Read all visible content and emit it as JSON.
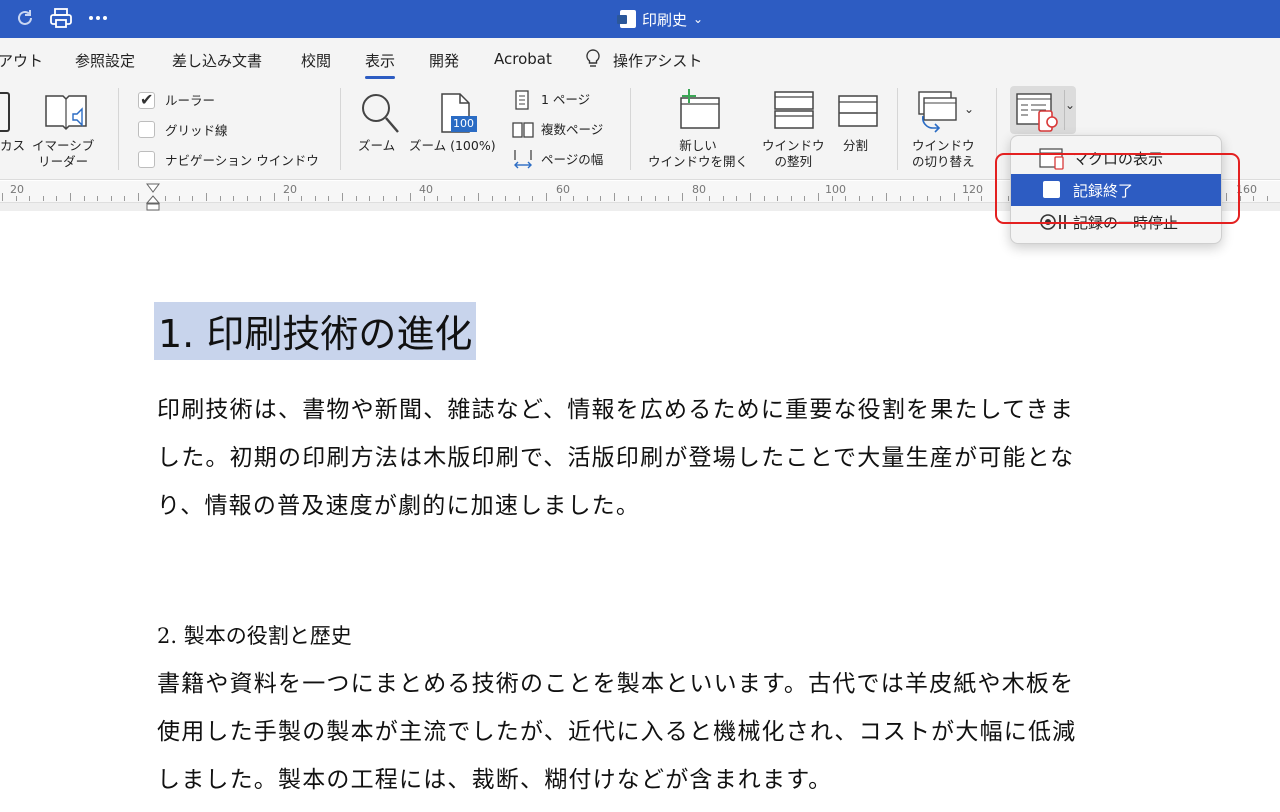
{
  "window": {
    "title": "印刷史"
  },
  "tabs": [
    {
      "label": "アウト"
    },
    {
      "label": "参照設定"
    },
    {
      "label": "差し込み文書"
    },
    {
      "label": "校閲"
    },
    {
      "label": "表示"
    },
    {
      "label": "開発"
    },
    {
      "label": "Acrobat"
    },
    {
      "label": "操作アシスト"
    }
  ],
  "ribbon": {
    "focus_label": "カス",
    "immersive_label": "イマーシブ",
    "immersive_label2": "リーダー",
    "ruler": "ルーラー",
    "gridlines": "グリッド線",
    "navigation": "ナビゲーション ウインドウ",
    "zoom": "ズーム",
    "zoom100": "ズーム (100%)",
    "zoom100_badge": "100",
    "one_page": "1 ページ",
    "multi_page": "複数ページ",
    "page_width": "ページの幅",
    "new_window_1": "新しい",
    "new_window_2": "ウインドウを開く",
    "arrange_1": "ウインドウ",
    "arrange_2": "の整列",
    "split": "分割",
    "switch_1": "ウインドウ",
    "switch_2": "の切り替え"
  },
  "ruler": {
    "numbers": [
      "20",
      "20",
      "40",
      "60",
      "80",
      "100",
      "120",
      "160"
    ]
  },
  "macro_menu": {
    "items": [
      {
        "label": "マクロの表示"
      },
      {
        "label": "記録終了"
      },
      {
        "label": "記録の一時停止"
      }
    ]
  },
  "document": {
    "heading1": "1. 印刷技術の進化",
    "para1": [
      "印刷技術は、書物や新聞、雑誌など、情報を広めるために重要な役割を果たしてきま",
      "した。初期の印刷方法は木版印刷で、活版印刷が登場したことで大量生産が可能とな",
      "り、情報の普及速度が劇的に加速しました。"
    ],
    "heading2": "2. 製本の役割と歴史",
    "para2": [
      "書籍や資料を一つにまとめる技術のことを製本といいます。古代では羊皮紙や木板を",
      "使用した手製の製本が主流でしたが、近代に入ると機械化され、コストが大幅に低減",
      "しました。製本の工程には、裁断、糊付けなどが含まれます。"
    ]
  },
  "colors": {
    "titlebar": "#2d5cc2",
    "selection": "#c8d4ec",
    "highlight_outline": "#e32020"
  }
}
